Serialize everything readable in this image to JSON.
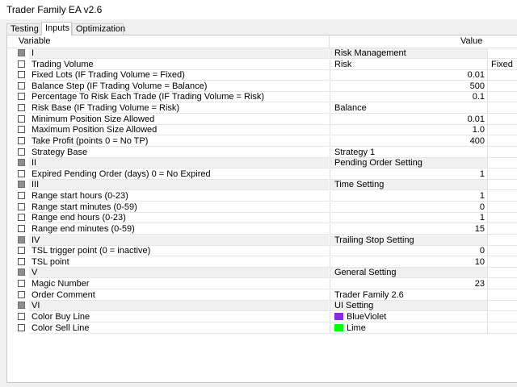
{
  "window": {
    "title": "Trader Family EA v2.6"
  },
  "tabs": [
    {
      "label": "Testing"
    },
    {
      "label": "Inputs"
    },
    {
      "label": "Optimization"
    }
  ],
  "table": {
    "headers": {
      "variable": "Variable",
      "value": "Value"
    },
    "rows": [
      {
        "name": "I",
        "value": "Risk Management",
        "group": true
      },
      {
        "name": "Trading Volume",
        "value": "Risk",
        "extra": "Fixed"
      },
      {
        "name": "Fixed Lots (IF Trading Volume = Fixed)",
        "value": "0.01",
        "numeric": true
      },
      {
        "name": "Balance Step (IF Trading Volume = Balance)",
        "value": "500",
        "numeric": true
      },
      {
        "name": "Percentage To Risk Each Trade (IF Trading Volume = Risk)",
        "value": "0.1",
        "numeric": true
      },
      {
        "name": "Risk Base (IF Trading Volume = Risk)",
        "value": "Balance"
      },
      {
        "name": "Minimum Position Size Allowed",
        "value": "0.01",
        "numeric": true
      },
      {
        "name": "Maximum Position Size Allowed",
        "value": "1.0",
        "numeric": true
      },
      {
        "name": "Take Profit (points 0 = No TP)",
        "value": "400",
        "numeric": true
      },
      {
        "name": "Strategy Base",
        "value": "Strategy 1"
      },
      {
        "name": "II",
        "value": "Pending Order Setting",
        "group": true
      },
      {
        "name": "Expired Pending Order (days) 0 = No Expired",
        "value": "1",
        "numeric": true
      },
      {
        "name": "III",
        "value": "Time Setting",
        "group": true
      },
      {
        "name": "Range start hours (0-23)",
        "value": "1",
        "numeric": true
      },
      {
        "name": "Range start minutes (0-59)",
        "value": "0",
        "numeric": true
      },
      {
        "name": "Range end hours (0-23)",
        "value": "1",
        "numeric": true
      },
      {
        "name": "Range end minutes (0-59)",
        "value": "15",
        "numeric": true
      },
      {
        "name": "IV",
        "value": "Trailing Stop Setting",
        "group": true
      },
      {
        "name": "TSL trigger point (0 = inactive)",
        "value": "0",
        "numeric": true
      },
      {
        "name": "TSL point",
        "value": "10",
        "numeric": true
      },
      {
        "name": "V",
        "value": "General Setting",
        "group": true
      },
      {
        "name": "Magic Number",
        "value": "23",
        "numeric": true
      },
      {
        "name": "Order Comment",
        "value": "Trader Family 2.6"
      },
      {
        "name": "VI",
        "value": "UI Setting",
        "group": true
      },
      {
        "name": "Color Buy Line",
        "value": "BlueViolet",
        "color": "#8a2be2"
      },
      {
        "name": "Color Sell Line",
        "value": "Lime",
        "color": "#00ff00"
      }
    ]
  }
}
